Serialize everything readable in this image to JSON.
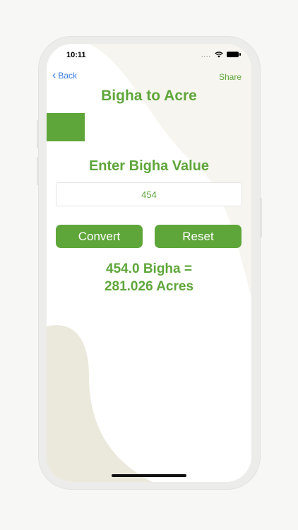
{
  "status_bar": {
    "time": "10:11",
    "signal_dots": "....",
    "wifi_icon": "wifi-icon",
    "battery_icon": "battery-icon"
  },
  "nav": {
    "back_label": "Back",
    "share_label": "Share"
  },
  "title": "Bigha to Acre",
  "prompt": "Enter Bigha Value",
  "input": {
    "value": "454",
    "placeholder": ""
  },
  "buttons": {
    "convert": "Convert",
    "reset": "Reset"
  },
  "result": {
    "line1": "454.0 Bigha =",
    "line2": "281.026 Acres"
  },
  "colors": {
    "accent": "#5fa63a",
    "link": "#3b7de0",
    "shape": "#ebe9dc"
  }
}
